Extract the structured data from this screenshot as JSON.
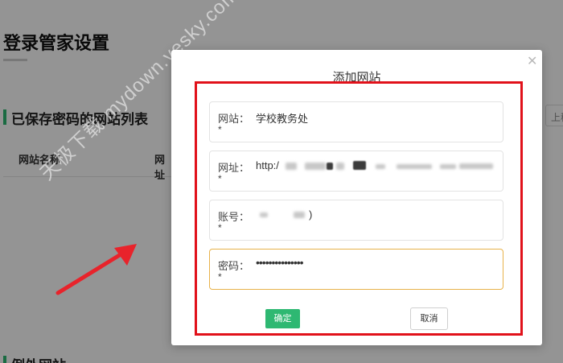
{
  "page": {
    "title": "登录管家设置",
    "saved_section_title": "已保存密码的网站列表",
    "exception_section_title": "例外网站",
    "table_headers": [
      "网站名称",
      "网址"
    ],
    "upload_label": "上移"
  },
  "watermark": "天极下载 mydown.yesky.com",
  "modal": {
    "title": "添加网站",
    "close_icon": "close-icon",
    "fields": {
      "site": {
        "label": "网站：",
        "required_mark": "*",
        "value": "学校教务处"
      },
      "url": {
        "label": "网址：",
        "required_mark": "*",
        "value": "http:/"
      },
      "account": {
        "label": "账号：",
        "required_mark": "*",
        "value": ")"
      },
      "password": {
        "label": "密码：",
        "required_mark": "*",
        "value": "•••••••••••••••"
      }
    },
    "ok_label": "确定",
    "cancel_label": "取消"
  },
  "colors": {
    "accent_green": "#2eb872",
    "highlight_red": "#e1111a",
    "focus_border": "#e8b24a",
    "arrow_red": "#e8232b"
  }
}
